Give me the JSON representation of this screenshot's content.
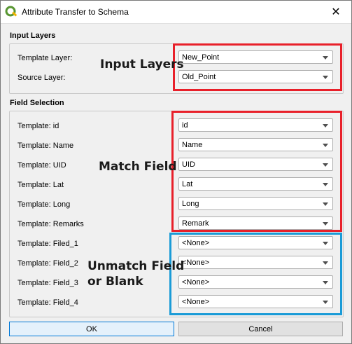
{
  "window": {
    "title": "Attribute Transfer to Schema",
    "close_glyph": "✕"
  },
  "input_layers": {
    "title": "Input Layers",
    "rows": [
      {
        "label": "Template Layer:",
        "value": "New_Point"
      },
      {
        "label": "Source Layer:",
        "value": "Old_Point"
      }
    ]
  },
  "field_selection": {
    "title": "Field Selection",
    "rows": [
      {
        "label": "Template: id",
        "value": "id"
      },
      {
        "label": "Template: Name",
        "value": "Name"
      },
      {
        "label": "Template: UID",
        "value": "UID"
      },
      {
        "label": "Template: Lat",
        "value": "Lat"
      },
      {
        "label": "Template: Long",
        "value": "Long"
      },
      {
        "label": "Template: Remarks",
        "value": "Remark"
      },
      {
        "label": "Template: Filed_1",
        "value": "<None>"
      },
      {
        "label": "Template: Field_2",
        "value": "<None>"
      },
      {
        "label": "Template: Field_3",
        "value": "<None>"
      },
      {
        "label": "Template: Field_4",
        "value": "<None>"
      }
    ]
  },
  "annotations": {
    "input_layers": "Input Layers",
    "match_field": "Match Field",
    "unmatch_line1": "Unmatch Field",
    "unmatch_line2": "or Blank"
  },
  "buttons": {
    "ok": "OK",
    "cancel": "Cancel"
  },
  "colors": {
    "annotation_red": "#e8202a",
    "annotation_blue": "#1a9bd7",
    "qgis_green": "#589632",
    "qgis_yellow": "#f0b400"
  }
}
